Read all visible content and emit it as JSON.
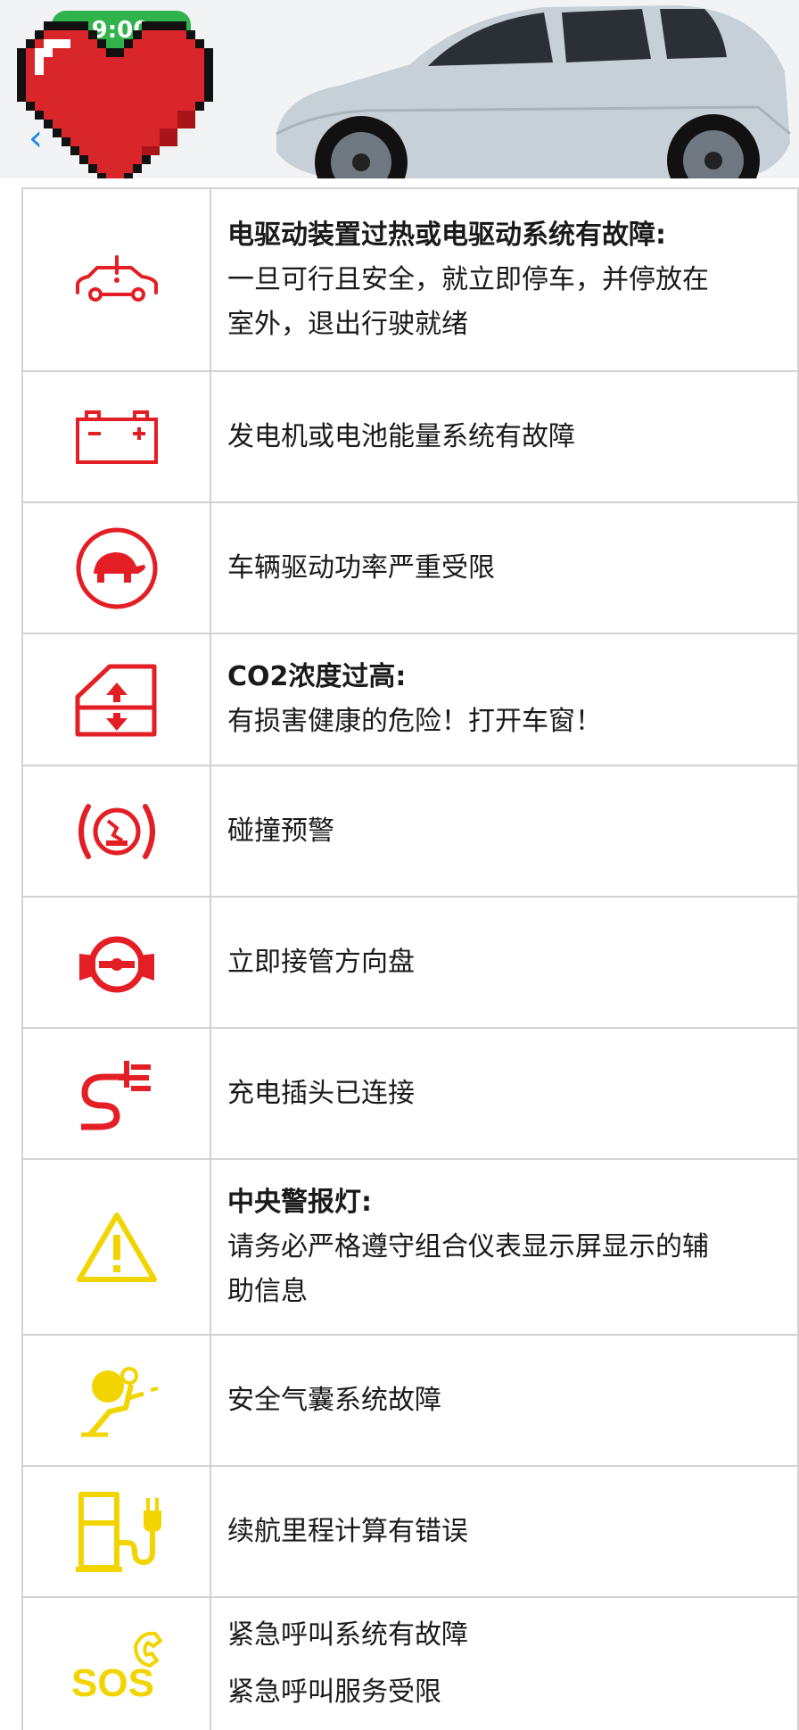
{
  "status_bar": {
    "time": "9:00"
  },
  "rows": [
    {
      "icon": "drive-fault-icon",
      "color": "#e31e24",
      "title": "电驱动装置过热或电驱动系统有故障:",
      "lines": [
        "一旦可行且安全，就立即停车，并停放在",
        "室外，退出行驶就绪"
      ]
    },
    {
      "icon": "battery-icon",
      "color": "#e31e24",
      "lines": [
        "发电机或电池能量系统有故障"
      ]
    },
    {
      "icon": "turtle-icon",
      "color": "#e31e24",
      "lines": [
        "车辆驱动功率严重受限"
      ]
    },
    {
      "icon": "window-icon",
      "color": "#e31e24",
      "title": "CO2浓度过高:",
      "lines": [
        "有损害健康的危险！打开车窗！"
      ]
    },
    {
      "icon": "collision-warning-icon",
      "color": "#e31e24",
      "lines": [
        "碰撞预警"
      ]
    },
    {
      "icon": "steering-wheel-hands-icon",
      "color": "#e31e24",
      "lines": [
        "立即接管方向盘"
      ]
    },
    {
      "icon": "charging-plug-icon",
      "color": "#e31e24",
      "lines": [
        "充电插头已连接"
      ]
    },
    {
      "icon": "warning-triangle-icon",
      "color": "#f2d500",
      "title": "中央警报灯:",
      "lines": [
        "请务必严格遵守组合仪表显示屏显示的辅",
        "助信息"
      ]
    },
    {
      "icon": "airbag-icon",
      "color": "#f2d500",
      "lines": [
        "安全气囊系统故障"
      ]
    },
    {
      "icon": "fuel-range-icon",
      "color": "#f2d500",
      "lines": [
        "续航里程计算有错误"
      ]
    },
    {
      "icon": "sos-icon",
      "color": "#f2d500",
      "lines": [
        "紧急呼叫系统有故障",
        "紧急呼叫服务受限"
      ]
    }
  ]
}
